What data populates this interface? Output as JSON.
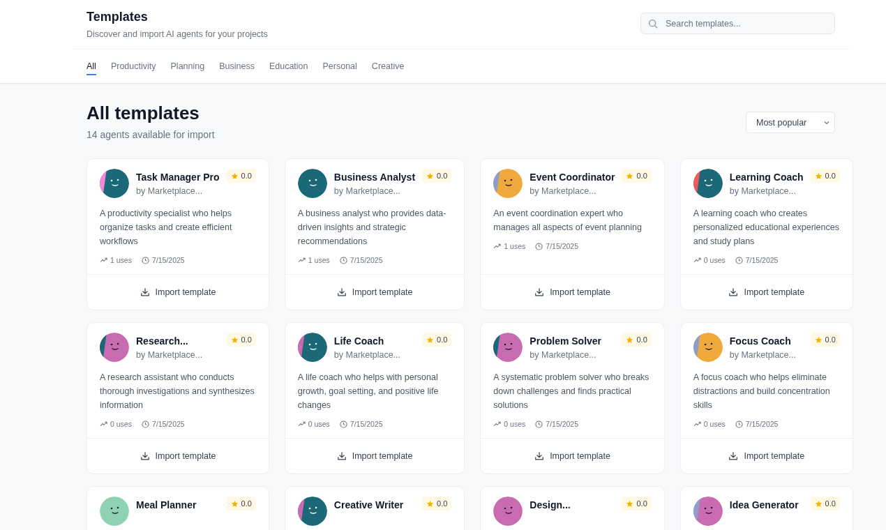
{
  "header": {
    "title": "Templates",
    "subtitle": "Discover and import AI agents for your projects",
    "search": {
      "placeholder": "Search templates..."
    }
  },
  "tabs": [
    {
      "label": "All",
      "selected": true
    },
    {
      "label": "Productivity",
      "selected": false
    },
    {
      "label": "Planning",
      "selected": false
    },
    {
      "label": "Business",
      "selected": false
    },
    {
      "label": "Education",
      "selected": false
    },
    {
      "label": "Personal",
      "selected": false
    },
    {
      "label": "Creative",
      "selected": false
    }
  ],
  "section": {
    "title": "All templates",
    "subtitle": "14 agents available for import",
    "sort": "Most popular"
  },
  "cards": [
    {
      "name": "Task Manager Pro",
      "author": "by Marketplace...",
      "rating": "0.0",
      "avatar": {
        "color": "#1b6878",
        "accent": {
          "color": "#f08ad8"
        }
      },
      "description": "A productivity specialist who helps organize tasks and create efficient workflows",
      "uses": "1 uses",
      "date": "7/15/2025",
      "button": "Import template"
    },
    {
      "name": "Business Analyst",
      "author": "by Marketplace...",
      "rating": "0.0",
      "avatar": {
        "color": "#1b6878"
      },
      "description": "A business analyst who provides data-driven insights and strategic recommendations",
      "uses": "1 uses",
      "date": "7/15/2025",
      "button": "Import template"
    },
    {
      "name": "Event Coordinator",
      "author": "by Marketplace...",
      "rating": "0.0",
      "avatar": {
        "color": "#f0a93c",
        "accent": {
          "color": "#8f9ec7"
        }
      },
      "description": "An event coordination expert who manages all aspects of event planning",
      "uses": "1 uses",
      "date": "7/15/2025",
      "button": "Import template"
    },
    {
      "name": "Learning Coach",
      "author": "by Marketplace...",
      "rating": "0.0",
      "avatar": {
        "color": "#1b6878",
        "accent": {
          "color": "#ef5b5b"
        }
      },
      "description": "A learning coach who creates personalized educational experiences and study plans",
      "uses": "0 uses",
      "date": "7/15/2025",
      "button": "Import template"
    },
    {
      "name": "Research...",
      "author": "by Marketplace...",
      "rating": "0.0",
      "avatar": {
        "color": "#c86bb0",
        "accent": {
          "color": "#1b6878"
        }
      },
      "description": "A research assistant who conducts thorough investigations and synthesizes information",
      "uses": "0 uses",
      "date": "7/15/2025",
      "button": "Import template"
    },
    {
      "name": "Life Coach",
      "author": "by Marketplace...",
      "rating": "0.0",
      "avatar": {
        "color": "#1b6878",
        "accent": {
          "color": "#c86bb0"
        }
      },
      "description": "A life coach who helps with personal growth, goal setting, and positive life changes",
      "uses": "0 uses",
      "date": "7/15/2025",
      "button": "Import template"
    },
    {
      "name": "Problem Solver",
      "author": "by Marketplace...",
      "rating": "0.0",
      "avatar": {
        "color": "#c86bb0",
        "accent": {
          "color": "#1b6878"
        }
      },
      "description": "A systematic problem solver who breaks down challenges and finds practical solutions",
      "uses": "0 uses",
      "date": "7/15/2025",
      "button": "Import template"
    },
    {
      "name": "Focus Coach",
      "author": "by Marketplace...",
      "rating": "0.0",
      "avatar": {
        "color": "#f0a93c",
        "accent": {
          "color": "#8f9ec7"
        }
      },
      "description": "A focus coach who helps eliminate distractions and build concentration skills",
      "uses": "0 uses",
      "date": "7/15/2025",
      "button": "Import template"
    },
    {
      "name": "Meal Planner",
      "rating": "0.0",
      "avatar": {
        "color": "#8fd1b0"
      }
    },
    {
      "name": "Creative Writer",
      "rating": "0.0",
      "avatar": {
        "color": "#1b6878",
        "accent": {
          "color": "#c86bb0"
        }
      }
    },
    {
      "name": "Design...",
      "rating": "0.0",
      "avatar": {
        "color": "#c86bb0"
      }
    },
    {
      "name": "Idea Generator",
      "rating": "0.0",
      "avatar": {
        "color": "#c86bb0",
        "accent": {
          "color": "#8f9ec7"
        }
      }
    }
  ]
}
